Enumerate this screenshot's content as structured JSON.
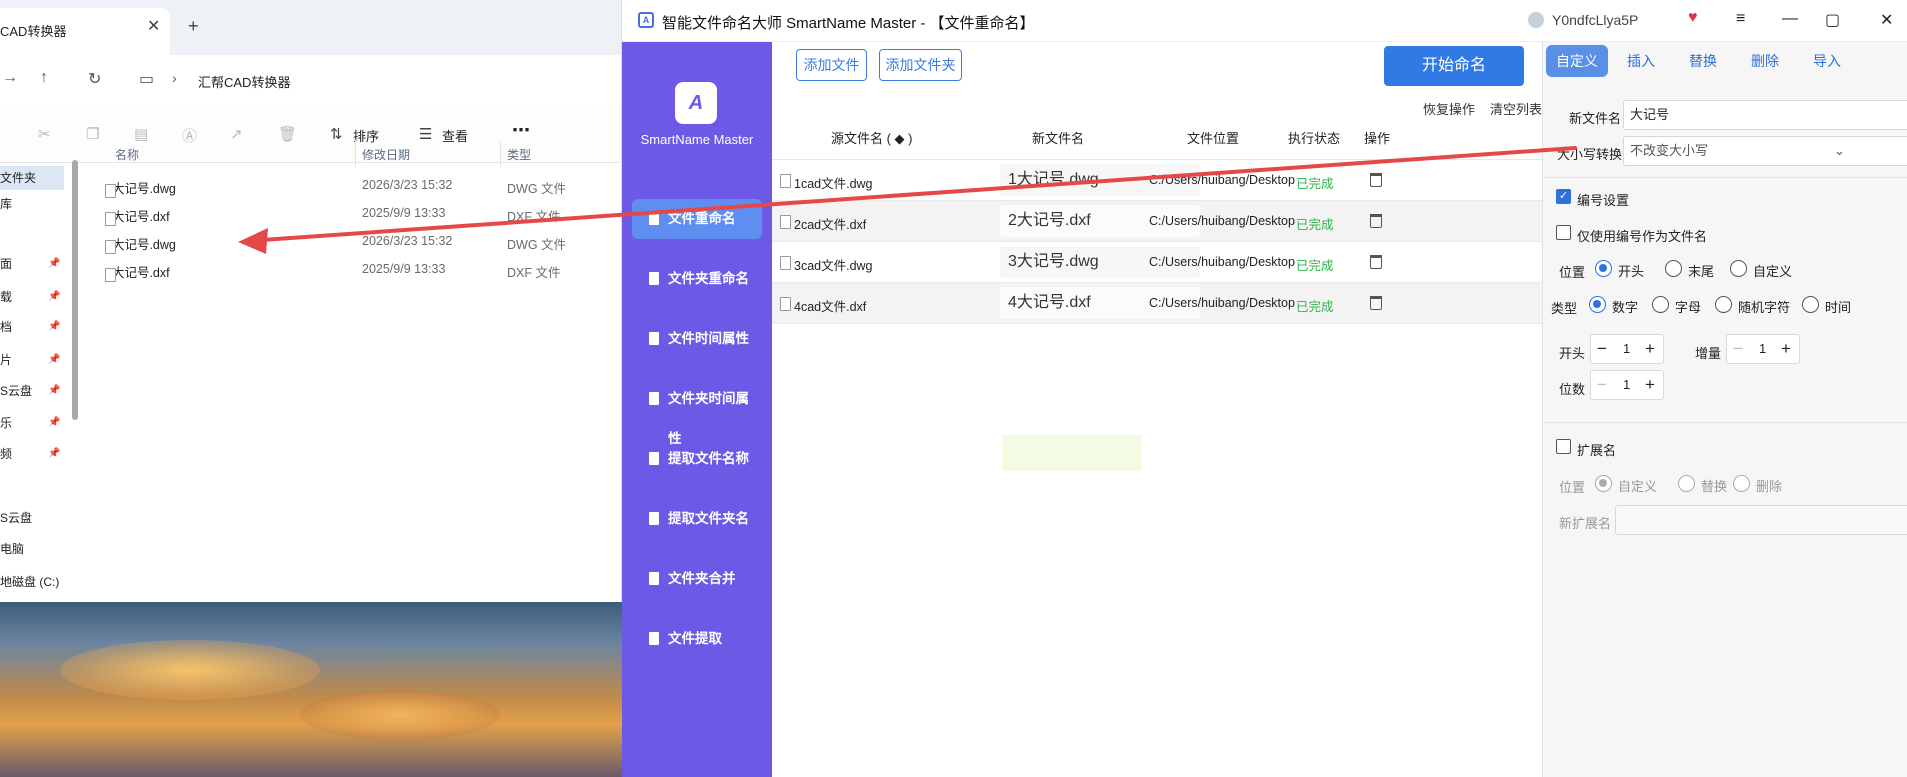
{
  "explorer": {
    "tab_title": "CAD转换器",
    "close_glyph": "✕",
    "newtab_glyph": "+",
    "breadcrumb": "汇帮CAD转换器",
    "toolbar": {
      "sort": "排序",
      "view": "查看",
      "more": "⋯"
    },
    "nav": [
      {
        "label": "文件夹",
        "selected": true,
        "pin": false
      },
      {
        "label": "库",
        "selected": false,
        "pin": false
      },
      {
        "label": "面",
        "selected": false,
        "pin": true
      },
      {
        "label": "载",
        "selected": false,
        "pin": true
      },
      {
        "label": "档",
        "selected": false,
        "pin": true
      },
      {
        "label": "片",
        "selected": false,
        "pin": true
      },
      {
        "label": "S云盘",
        "selected": false,
        "pin": true
      },
      {
        "label": "乐",
        "selected": false,
        "pin": true
      },
      {
        "label": "频",
        "selected": false,
        "pin": true
      },
      {
        "label": "S云盘",
        "selected": false,
        "pin": false
      },
      {
        "label": "电脑",
        "selected": false,
        "pin": false
      },
      {
        "label": "地磁盘 (C:)",
        "selected": false,
        "pin": false
      }
    ],
    "columns": {
      "name": "名称",
      "date": "修改日期",
      "type": "类型"
    },
    "files": [
      {
        "name": "1大记号.dwg",
        "date": "2026/3/23 15:32",
        "type": "DWG 文件"
      },
      {
        "name": "2大记号.dxf",
        "date": "2025/9/9 13:33",
        "type": "DXF 文件"
      },
      {
        "name": "3大记号.dwg",
        "date": "2026/3/23 15:32",
        "type": "DWG 文件"
      },
      {
        "name": "4大记号.dxf",
        "date": "2025/9/9 13:33",
        "type": "DXF 文件"
      }
    ]
  },
  "app": {
    "title": "智能文件命名大师 SmartName Master - 【文件重命名】",
    "user": "Y0ndfcLlya5P",
    "logo_text": "SmartName Master",
    "logo_glyph": "A",
    "sidebar": [
      "文件重命名",
      "文件夹重命名",
      "文件时间属性",
      "文件夹时间属性",
      "提取文件名称",
      "提取文件夹名",
      "文件夹合并",
      "文件提取"
    ],
    "buttons": {
      "add_file": "添加文件",
      "add_folder": "添加文件夹",
      "start": "开始命名",
      "undo": "恢复操作",
      "clear": "清空列表"
    },
    "table": {
      "headers": {
        "src": "源文件名 ( ◆ )",
        "new": "新文件名",
        "loc": "文件位置",
        "status": "执行状态",
        "op": "操作"
      },
      "rows": [
        {
          "src": "1cad文件.dwg",
          "new": "1大记号.dwg",
          "loc": "C:/Users/huibang/Desktop",
          "status": "已完成"
        },
        {
          "src": "2cad文件.dxf",
          "new": "2大记号.dxf",
          "loc": "C:/Users/huibang/Desktop",
          "status": "已完成"
        },
        {
          "src": "3cad文件.dwg",
          "new": "3大记号.dwg",
          "loc": "C:/Users/huibang/Desktop",
          "status": "已完成"
        },
        {
          "src": "4cad文件.dxf",
          "new": "4大记号.dxf",
          "loc": "C:/Users/huibang/Desktop",
          "status": "已完成"
        }
      ]
    },
    "right": {
      "tabs": [
        "自定义",
        "插入",
        "替换",
        "删除",
        "导入"
      ],
      "new_name_label": "新文件名",
      "new_name_value": "大记号",
      "case_label": "大小写转换",
      "case_value": "不改变大小写",
      "numbering": "编号设置",
      "only_number": "仅使用编号作为文件名",
      "pos_label": "位置",
      "pos_opts": [
        "开头",
        "末尾",
        "自定义"
      ],
      "type_label": "类型",
      "type_opts": [
        "数字",
        "字母",
        "随机字符",
        "时间"
      ],
      "start_label": "开头",
      "start_val": "1",
      "inc_label": "增量",
      "inc_val": "1",
      "digits_label": "位数",
      "digits_val": "1",
      "ext_label": "扩展名",
      "ext_pos_label": "位置",
      "ext_opts": [
        "自定义",
        "替换",
        "删除"
      ],
      "new_ext_label": "新扩展名"
    }
  }
}
